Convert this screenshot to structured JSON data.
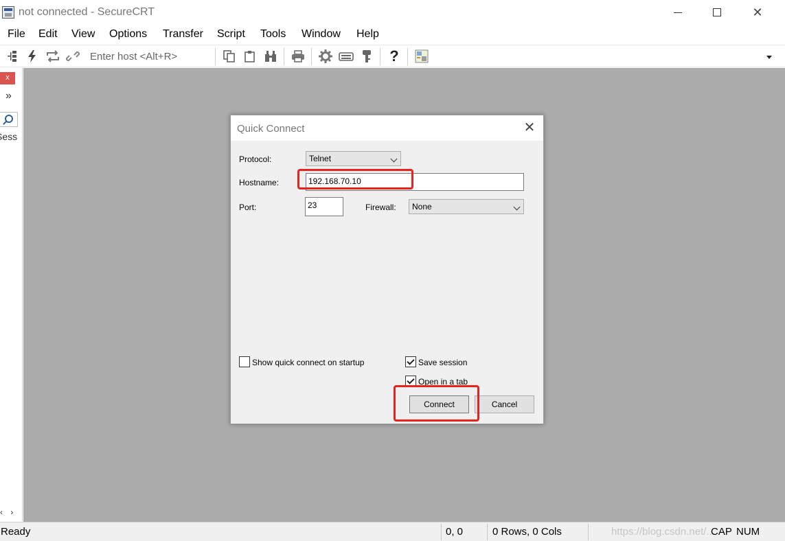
{
  "window": {
    "title": "not connected - SecureCRT"
  },
  "menu": {
    "items": [
      "File",
      "Edit",
      "View",
      "Options",
      "Transfer",
      "Script",
      "Tools",
      "Window",
      "Help"
    ]
  },
  "toolbar": {
    "host_placeholder": "Enter host <Alt+R>",
    "help_glyph": "?"
  },
  "left_panel": {
    "close_glyph": "x",
    "expand_glyph": "»",
    "sessions_label": "Sess",
    "scroll_arrows": "‹ ›"
  },
  "dialog": {
    "title": "Quick Connect",
    "protocol_label": "Protocol:",
    "protocol_value": "Telnet",
    "hostname_label": "Hostname:",
    "hostname_value": "192.168.70.10",
    "port_label": "Port:",
    "port_value": "23",
    "firewall_label": "Firewall:",
    "firewall_value": "None",
    "show_on_startup_label": "Show quick connect on startup",
    "show_on_startup_checked": false,
    "save_session_label": "Save session",
    "save_session_checked": true,
    "open_in_tab_label": "Open in a tab",
    "open_in_tab_checked": true,
    "connect_label": "Connect",
    "cancel_label": "Cancel"
  },
  "statusbar": {
    "status": "Ready",
    "cursor": "0, 0",
    "dimensions": "0 Rows, 0 Cols",
    "watermark": "https://blog.csdn.net/...",
    "cap": "CAP",
    "num": "NUM"
  },
  "colors": {
    "highlight_annotation": "#e8231f",
    "workspace": "#ababab",
    "dialog_bg": "#f0f0f0"
  }
}
